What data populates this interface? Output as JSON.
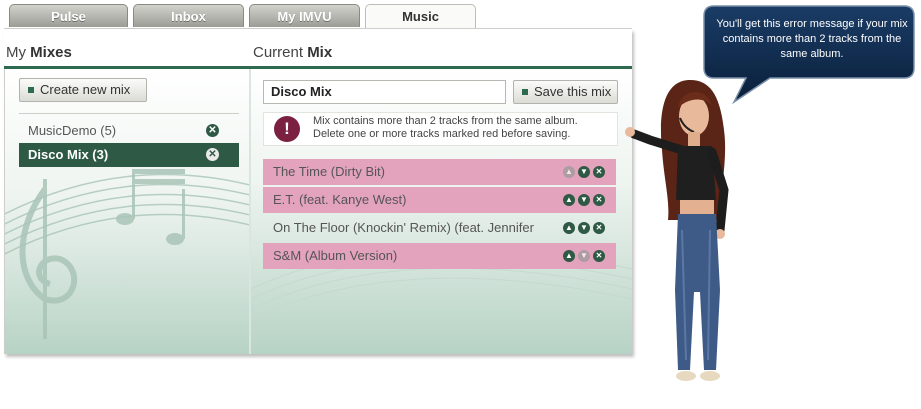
{
  "tabs": [
    {
      "label": "Pulse"
    },
    {
      "label": "Inbox"
    },
    {
      "label": "My IMVU"
    },
    {
      "label": "Music"
    }
  ],
  "left": {
    "heading_light": "My ",
    "heading_bold": "Mixes",
    "create_button": "Create new mix",
    "mixes": [
      {
        "label": "MusicDemo (5)",
        "selected": false
      },
      {
        "label": "Disco Mix (3)",
        "selected": true
      }
    ]
  },
  "right": {
    "heading_light": "Current ",
    "heading_bold": "Mix",
    "mix_name": "Disco Mix",
    "save_button": "Save this mix",
    "error_icon": "!",
    "error_line1": "Mix contains more than 2 tracks from the same album.",
    "error_line2": "Delete one or more tracks marked red before saving.",
    "tracks": [
      {
        "title": "The Time (Dirty Bit)",
        "flagged": true
      },
      {
        "title": "E.T. (feat. Kanye West)",
        "flagged": true
      },
      {
        "title": "On The Floor (Knockin' Remix) (feat. Jennifer",
        "flagged": false
      },
      {
        "title": "S&M (Album Version)",
        "flagged": true
      }
    ]
  },
  "callout": {
    "text": "You'll get this error message if your mix contains more than 2 tracks from the same album."
  },
  "colors": {
    "accent": "#2e6a4f",
    "flagged_row": "#e4a3bd",
    "error_icon": "#7b2040",
    "bubble": "#0d2746"
  },
  "icons": {
    "remove": "close-icon",
    "up": "arrow-up-icon",
    "down": "arrow-down-icon",
    "error": "error-icon"
  }
}
